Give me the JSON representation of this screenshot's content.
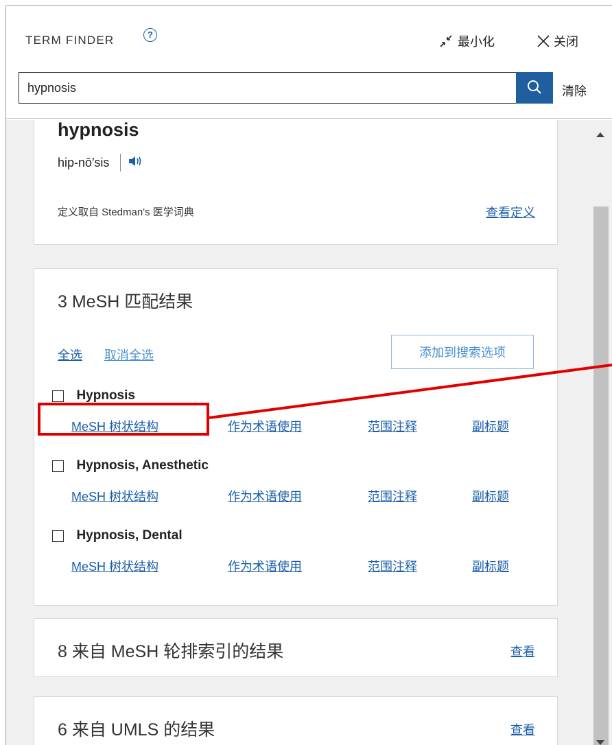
{
  "header": {
    "title": "TERM FINDER",
    "help_icon": "question-circle-icon",
    "minimize_label": "最小化",
    "close_label": "关闭"
  },
  "search": {
    "value": "hypnosis",
    "button_icon": "search-icon",
    "clear_label": "清除"
  },
  "definition": {
    "term": "hypnosis",
    "pronunciation": "hip-nō′sis",
    "audio_icon": "speaker-icon",
    "source": "定义取自 Stedman's 医学词典",
    "view_link": "查看定义"
  },
  "mesh": {
    "heading": "3 MeSH 匹配结果",
    "select_all": "全选",
    "deselect_all": "取消全选",
    "add_button": "添加到搜索选项",
    "link_labels": {
      "tree": "MeSH 树状结构",
      "use_as_term": "作为术语使用",
      "scope_note": "范围注释",
      "subheadings": "副标题"
    },
    "terms": [
      {
        "name": "Hypnosis"
      },
      {
        "name": "Hypnosis, Anesthetic"
      },
      {
        "name": "Hypnosis, Dental"
      }
    ]
  },
  "permuted": {
    "text": "8 来自 MeSH 轮排索引的结果",
    "link": "查看"
  },
  "umls": {
    "text": "6 来自 UMLS 的结果",
    "link": "查看"
  },
  "colors": {
    "link": "#1a5ea8",
    "search_button": "#1f5f9f",
    "annotation": "#e00000"
  }
}
